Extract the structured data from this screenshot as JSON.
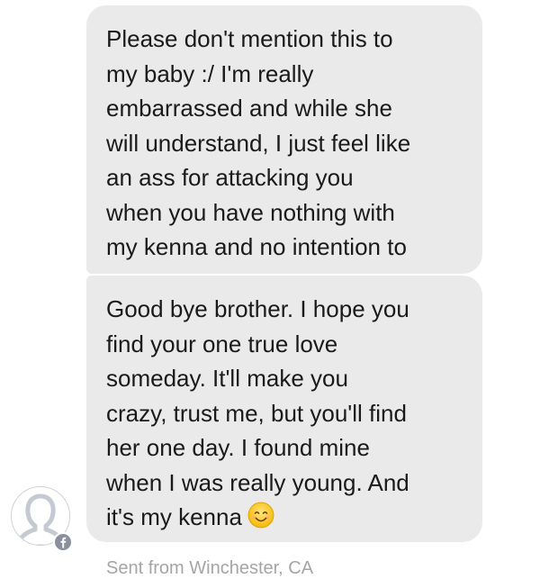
{
  "messages": [
    {
      "text": "Please don't mention this to\nmy baby :/ I'm really\nembarrassed and while she\nwill understand, I just feel like\nan ass for attacking you\nwhen you have nothing with\nmy kenna and no intention to"
    },
    {
      "text": "Good bye brother. I hope you\nfind your one true love\nsomeday. It'll make you\ncrazy, trust me, but you'll find\nher one day. I found mine\nwhen I was really young. And\nit's my kenna",
      "emoji": "smiling-face-emoji"
    }
  ],
  "sender": {
    "avatar_icon": "default-profile-silhouette-icon",
    "badge_icon": "facebook-icon"
  },
  "footer": {
    "location_text": "Sent from Winchester, CA"
  },
  "colors": {
    "bubble": "#eaeaea",
    "text": "#1a1a1a",
    "meta": "#a5a5a5",
    "badge": "#898f9c"
  }
}
